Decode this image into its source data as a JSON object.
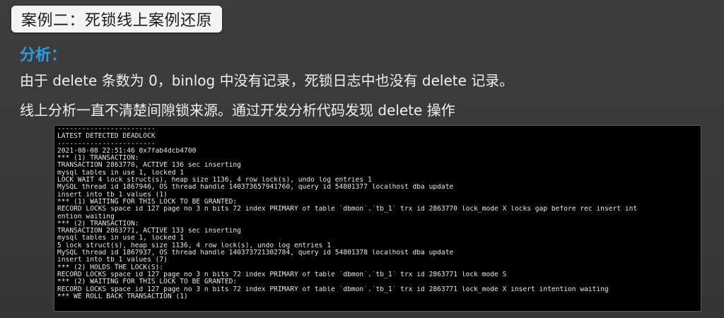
{
  "title": "案例二：死锁线上案例还原",
  "section_label": "分析：",
  "body_lines": [
    "由于 delete 条数为 0，binlog 中没有记录，死锁日志中也没有 delete 记录。",
    "线上分析一直不清楚间隙锁来源。通过开发分析代码发现 delete 操作"
  ],
  "console": {
    "lines": [
      "------------------------",
      "LATEST DETECTED DEADLOCK",
      "------------------------",
      "2021-08-08 22:51:46 0x7fab4dcb4700",
      "*** (1) TRANSACTION:",
      "TRANSACTION 2863770, ACTIVE 136 sec inserting",
      "mysql tables in use 1, locked 1",
      "LOCK WAIT 4 lock struct(s), heap size 1136, 4 row lock(s), undo log entries 1",
      "MySQL thread id 1867946, OS thread handle 140373657941760, query id 54801377 localhost dba update",
      "insert into tb_1 values (1)",
      "*** (1) WAITING FOR THIS LOCK TO BE GRANTED:",
      "RECORD LOCKS space id 127 page no 3 n bits 72 index PRIMARY of table `dbmon`.`tb_1` trx id 2863770 lock_mode X locks gap before rec insert int",
      "ention waiting",
      "*** (2) TRANSACTION:",
      "TRANSACTION 2863771, ACTIVE 133 sec inserting",
      "mysql tables in use 1, locked 1",
      "5 lock struct(s), heap size 1136, 4 row lock(s), undo log entries 1",
      "MySQL thread id 1867937, OS thread handle 140373721302784, query id 54801378 localhost dba update",
      "insert into tb_1 values (7)",
      "*** (2) HOLDS THE LOCK(S):",
      "RECORD LOCKS space id 127 page no 3 n bits 72 index PRIMARY of table `dbmon`.`tb_1` trx id 2863771 lock mode S",
      "*** (2) WAITING FOR THIS LOCK TO BE GRANTED:",
      "RECORD LOCKS space id 127 page no 3 n bits 72 index PRIMARY of table `dbmon`.`tb_1` trx id 2863771 lock_mode X insert intention waiting",
      "*** WE ROLL BACK TRANSACTION (1)"
    ]
  }
}
